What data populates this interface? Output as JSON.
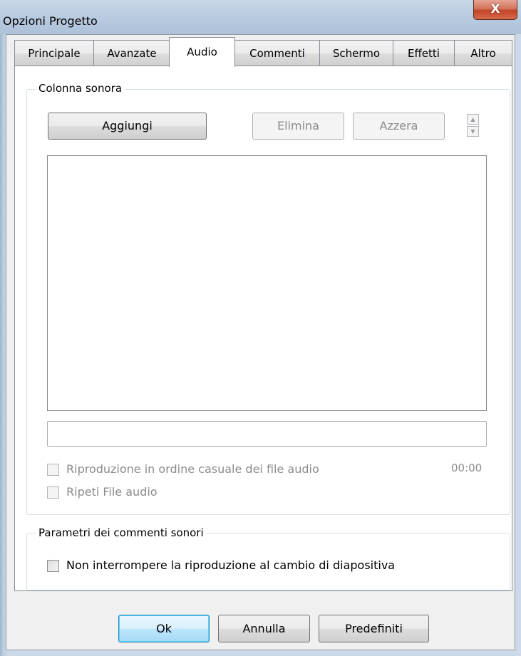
{
  "window": {
    "title": "Opzioni Progetto",
    "close_glyph": "X"
  },
  "tabs": [
    {
      "label": "Principale",
      "active": false
    },
    {
      "label": "Avanzate",
      "active": false
    },
    {
      "label": "Audio",
      "active": true
    },
    {
      "label": "Commenti",
      "active": false
    },
    {
      "label": "Schermo",
      "active": false
    },
    {
      "label": "Effetti",
      "active": false
    },
    {
      "label": "Altro",
      "active": false
    }
  ],
  "soundtrack": {
    "group_label": "Colonna sonora",
    "add_label": "Aggiungi",
    "delete_label": "Elimina",
    "reset_label": "Azzera",
    "move_up_icon": "arrow-up-icon",
    "move_down_icon": "arrow-down-icon",
    "file_list": [],
    "path_value": "",
    "time_display": "00:00",
    "shuffle_label": "Riproduzione in ordine casuale dei file audio",
    "shuffle_checked": false,
    "repeat_label": "Ripeti File audio",
    "repeat_checked": false
  },
  "comments": {
    "group_label": "Parametri dei commenti sonori",
    "no_interrupt_label": "Non interrompere la riproduzione al cambio di diapositiva",
    "no_interrupt_checked": false
  },
  "footer": {
    "ok_label": "Ok",
    "cancel_label": "Annulla",
    "defaults_label": "Predefiniti"
  },
  "colors": {
    "title_bar": "#b9cbe0",
    "close_button": "#c24428",
    "default_button_border": "#3c7fb1"
  }
}
